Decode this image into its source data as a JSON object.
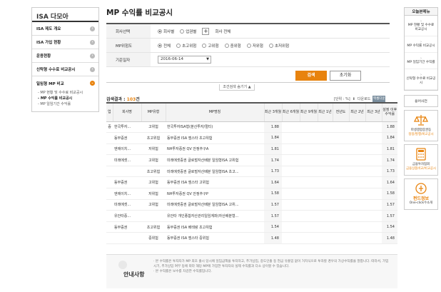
{
  "leftnav": {
    "title": "ISA 다모아",
    "items": [
      {
        "label": "ISA 제도 개요"
      },
      {
        "label": "ISA 가입 현황"
      },
      {
        "label": "운용현황"
      },
      {
        "label": "신탁형 수수료 비교공시"
      },
      {
        "label": "일임형 MP 비교"
      }
    ],
    "subitems": [
      {
        "label": "- MP 현황 및 수수료 비교공시"
      },
      {
        "label": "- MP 수익률 비교공시"
      },
      {
        "label": "- MP 일임기간 수익률"
      }
    ]
  },
  "page": {
    "title": "MP 수익률 비교공시"
  },
  "filter": {
    "company_label": "회사선택",
    "company_opts": [
      "회사별",
      "업권별"
    ],
    "company_all": "회사 전체",
    "risk_label": "MP위험도",
    "risk_opts": [
      "전체",
      "초고위험",
      "고위험",
      "중위험",
      "저위험",
      "초저위험"
    ],
    "date_label": "기준일자",
    "date_value": "2016-06-14",
    "search_btn": "검색",
    "reset_btn": "초기화",
    "collapse": "조건검색 숨기기 ▲"
  },
  "result": {
    "prefix": "검색결과 :",
    "count": "103",
    "suffix": "건"
  },
  "tools": {
    "unit": "[단위 : %]",
    "print": "다운로드",
    "excel": "엑셀다운로드"
  },
  "table": {
    "headers": [
      "업",
      "회사명",
      "MP유형",
      "MP명칭",
      "최근 3개월",
      "최근 6개월",
      "최근 9개월",
      "최근 1년",
      "전년도",
      "최근 2년",
      "최근 3년",
      "설정 이후 수익률"
    ],
    "rows": [
      [
        "증",
        "한국투자...",
        "고위험",
        "한국투자ISA형(분산투자/멀티)",
        "1.88",
        "",
        "",
        "",
        "",
        "",
        "",
        "1.88"
      ],
      [
        "",
        "동부증권",
        "초고위험",
        "동부증권 ISA 엠스타 초고위험",
        "1.84",
        "",
        "",
        "",
        "",
        "",
        "",
        "1.84"
      ],
      [
        "",
        "엔에이치...",
        "저위험",
        "NH투자증권 QV 안정추구A",
        "1.81",
        "",
        "",
        "",
        "",
        "",
        "",
        "1.81"
      ],
      [
        "",
        "미래에셋...",
        "고위험",
        "미래에셋증권 글로벌자산배분 일임형ISA 고위험",
        "1.74",
        "",
        "",
        "",
        "",
        "",
        "",
        "1.74"
      ],
      [
        "",
        "",
        "초고위험",
        "미래에셋증권 글로벌자산배분 일임형ISA 초고...",
        "1.73",
        "",
        "",
        "",
        "",
        "",
        "",
        "1.73"
      ],
      [
        "",
        "동부증권",
        "고위험",
        "동부증권 ISA 엠스타 고위험",
        "1.64",
        "",
        "",
        "",
        "",
        "",
        "",
        "1.64"
      ],
      [
        "",
        "엔에이치...",
        "저위험",
        "NH투자증권 QV 안정추구P",
        "1.58",
        "",
        "",
        "",
        "",
        "",
        "",
        "1.58"
      ],
      [
        "",
        "미래에셋...",
        "고위험",
        "미래에셋증권 글로벌자산배분 일임형ISA 고위...",
        "1.57",
        "",
        "",
        "",
        "",
        "",
        "",
        "1.57"
      ],
      [
        "",
        "유안타증...",
        "",
        "유안타 개인종합자산관리일임계좌(자산배분형...",
        "1.57",
        "",
        "",
        "",
        "",
        "",
        "",
        "1.57"
      ],
      [
        "",
        "동부증권",
        "초고위험",
        "동부증권 ISA 베테랑 초고위험",
        "1.54",
        "",
        "",
        "",
        "",
        "",
        "",
        "1.54"
      ],
      [
        "",
        "",
        "중위험",
        "동부증권 ISA 엠스타 중위험",
        "1.48",
        "",
        "",
        "",
        "",
        "",
        "",
        "1.48"
      ]
    ]
  },
  "notice": {
    "title": "안내사항",
    "line1": "· 본 수익률은 투자자가 MP 최초 출시 당시에 일임금액을 투자하고, 추가납입, 중도인출 등 현금 유출입 없이 거치식으로 투자할 경우의 가상수익률을 말합니다. 따라서, 가입시기, 추가납입 여부 등에 따라 해당 MP에 가입한 투자자의 실제 수익률과 다소 상이할 수 있습니다.",
    "line2": "· 본 수익률은 보수를 차감한 수익률입니다."
  },
  "rightbar": {
    "head": "오늘본메뉴",
    "items": [
      "MP 현황 및 수수료 비교공시",
      "MP 수익률 비교공시",
      "MP 일임기간 수익률",
      "신탁형 수수료 비교공시"
    ],
    "sep": "용어사전",
    "icons": [
      {
        "l1": "파생결합증권등",
        "l2": "정정/발행/비교공시"
      },
      {
        "l1": "금융투자협회",
        "l2": "금융상품비교/비교공시"
      },
      {
        "l1": "펀드정보",
        "l2": "One-click수소개"
      }
    ]
  },
  "colors": {
    "accent": "#e8830e"
  }
}
